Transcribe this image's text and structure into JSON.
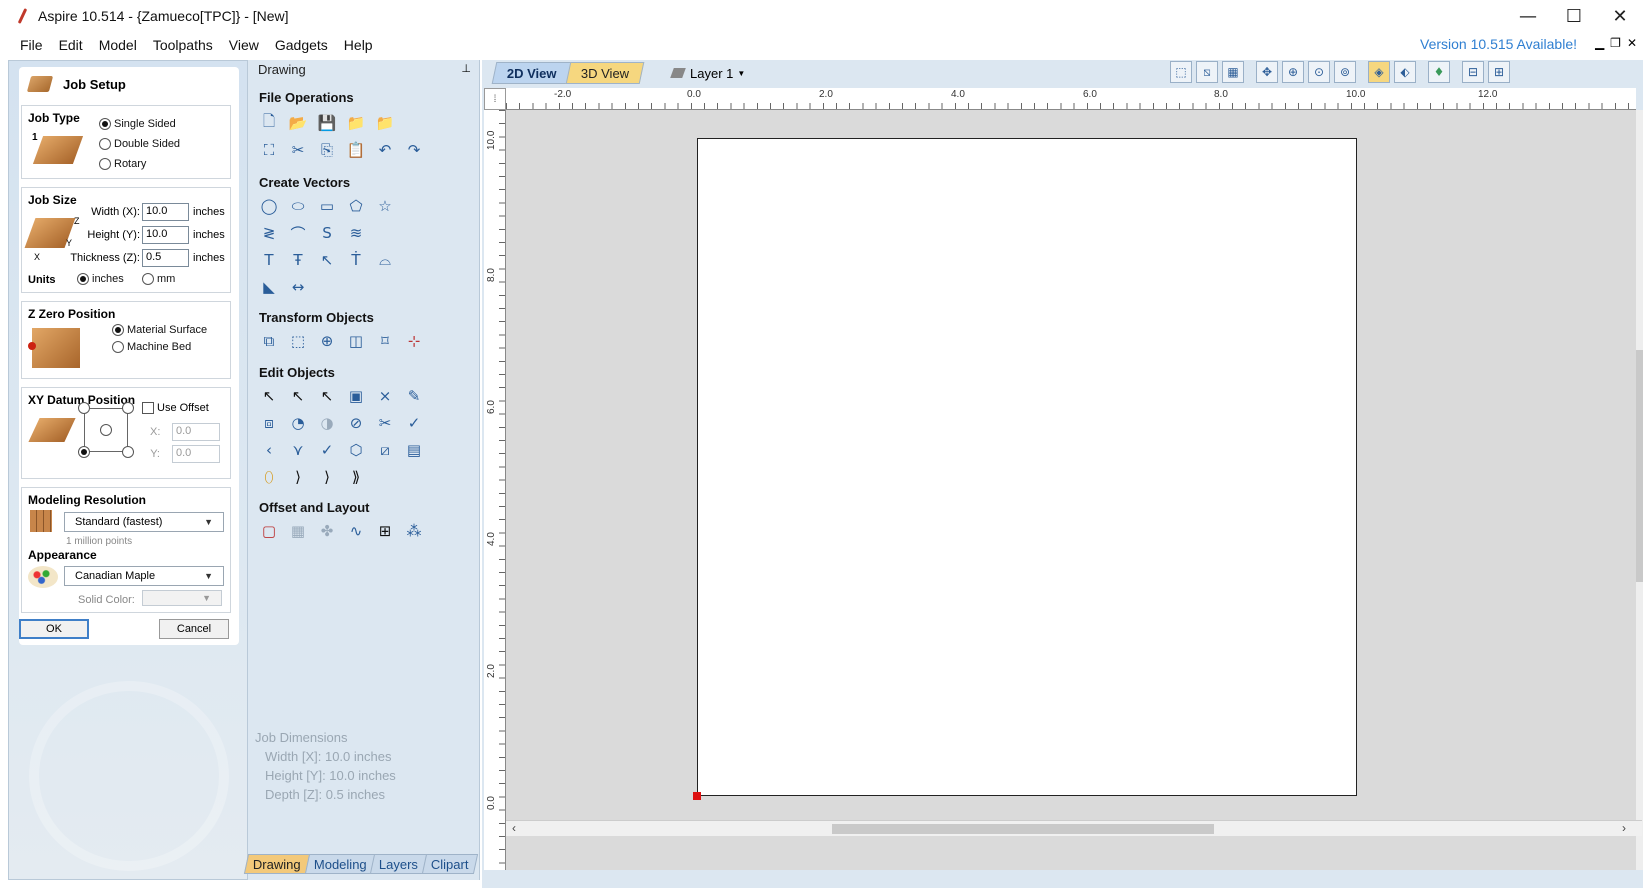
{
  "titlebar": {
    "title": "Aspire 10.514 - {Zamueco[TPC]} - [New]",
    "minimize": "—",
    "maximize": "☐",
    "close": "✕"
  },
  "menu": {
    "items": [
      "File",
      "Edit",
      "Model",
      "Toolpaths",
      "View",
      "Gadgets",
      "Help"
    ],
    "version_notice": "Version 10.515 Available!"
  },
  "job_setup": {
    "title": "Job Setup",
    "job_type": {
      "title": "Job Type",
      "step": "1",
      "options": [
        "Single Sided",
        "Double Sided",
        "Rotary"
      ],
      "selected": "Single Sided"
    },
    "job_size": {
      "title": "Job Size",
      "width_label": "Width (X):",
      "width": "10.0",
      "height_label": "Height (Y):",
      "height": "10.0",
      "thickness_label": "Thickness (Z):",
      "thickness": "0.5",
      "unit": "inches",
      "axis_z": "Z",
      "axis_y": "Y",
      "axis_x": "X",
      "units_title": "Units",
      "units_options": [
        "inches",
        "mm"
      ],
      "units_selected": "inches"
    },
    "z_zero": {
      "title": "Z Zero Position",
      "options": [
        "Material Surface",
        "Machine Bed"
      ],
      "selected": "Material Surface"
    },
    "xy_datum": {
      "title": "XY Datum Position",
      "use_offset_label": "Use Offset",
      "x_label": "X:",
      "x": "0.0",
      "y_label": "Y:",
      "y": "0.0"
    },
    "modeling": {
      "title": "Modeling Resolution",
      "resolution": "Standard (fastest)",
      "points_hint": "1 million points"
    },
    "appearance": {
      "title": "Appearance",
      "material": "Canadian Maple",
      "solid_color_label": "Solid Color:"
    },
    "ok_label": "OK",
    "cancel_label": "Cancel"
  },
  "drawing_panel": {
    "title": "Drawing",
    "pin": "⊥",
    "sections": {
      "file_operations": "File Operations",
      "create_vectors": "Create Vectors",
      "transform_objects": "Transform Objects",
      "edit_objects": "Edit Objects",
      "offset_layout": "Offset and Layout"
    },
    "job_dimensions": {
      "title": "Job Dimensions",
      "width": "Width  [X]: 10.0 inches",
      "height": "Height [Y]: 10.0 inches",
      "depth": "Depth  [Z]: 0.5 inches"
    },
    "tabs": [
      "Drawing",
      "Modeling",
      "Layers",
      "Clipart"
    ]
  },
  "view": {
    "tabs": [
      "2D View",
      "3D View"
    ],
    "layer": "Layer 1",
    "ruler_top": [
      "-2.0",
      "0.0",
      "2.0",
      "4.0",
      "6.0",
      "8.0",
      "10.0",
      "12.0"
    ],
    "ruler_left": [
      "10.0",
      "8.0",
      "6.0",
      "4.0",
      "2.0",
      "0.0"
    ]
  },
  "colors": {
    "accent": "#2f7fd1",
    "panel_bg": "#dce7f1",
    "tab_active": "#f3c97a",
    "origin": "#dd1111"
  }
}
